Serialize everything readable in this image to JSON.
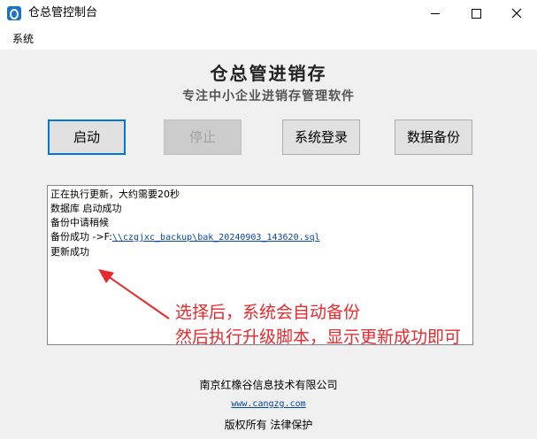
{
  "window": {
    "title": "仓总管控制台"
  },
  "menu": {
    "items": [
      "系统"
    ]
  },
  "header": {
    "title": "仓总管进销存",
    "subtitle": "专注中小企业进销存管理软件"
  },
  "buttons": {
    "start": "启动",
    "stop": "停止",
    "login": "系统登录",
    "backup": "数据备份"
  },
  "log": {
    "lines": [
      "正在执行更新，大约需要20秒",
      "数据库 启动成功",
      "备份中请稍候"
    ],
    "backup_prefix": "备份成功 ->F:",
    "backup_path": "\\\\czgjxc_backup\\bak_20240903_143620.sql",
    "last_line": "更新成功"
  },
  "annotation": {
    "line1": "选择后，系统会自动备份",
    "line2": "然后执行升级脚本，显示更新成功即可",
    "color": "#e8292d"
  },
  "footer": {
    "company": "南京红橡谷信息技术有限公司",
    "website": "www.cangzg.com",
    "copyright": "版权所有 法律保护"
  },
  "icons": {
    "app": "warehouse-app-icon",
    "minimize": "minimize-icon",
    "maximize": "maximize-icon",
    "close": "close-icon",
    "arrow": "red-arrow-icon"
  },
  "colors": {
    "accent": "#0078d7",
    "link": "#0645ad"
  }
}
